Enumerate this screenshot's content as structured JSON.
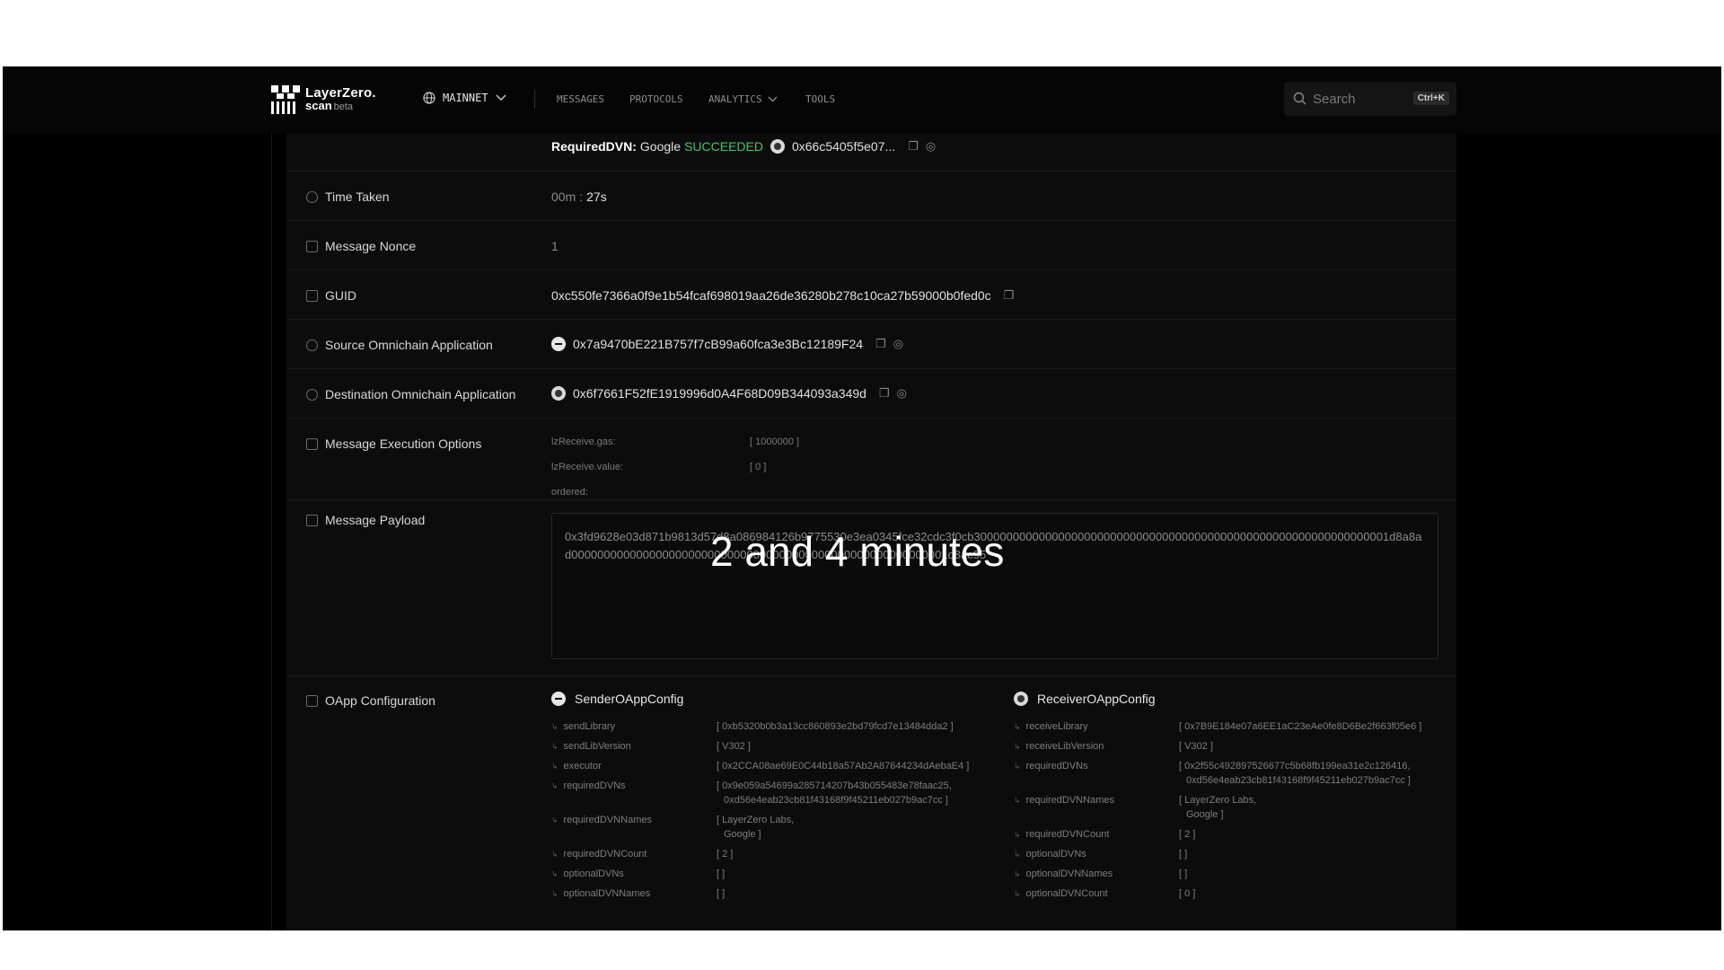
{
  "header": {
    "logo_line1": "LayerZero.",
    "logo_line2": "scan",
    "logo_badge": "beta",
    "network": "MAINNET",
    "nav": [
      "MESSAGES",
      "PROTOCOLS",
      "ANALYTICS",
      "TOOLS"
    ],
    "search_placeholder": "Search",
    "search_shortcut": "Ctrl+K"
  },
  "dvn_row": {
    "label": "RequiredDVN:",
    "name": "Google",
    "status": "SUCCEEDED",
    "address": "0x66c5405f5e07..."
  },
  "rows": {
    "time_taken": {
      "label": "Time Taken",
      "minutes": "00m",
      "sep": ":",
      "seconds": "27s"
    },
    "nonce": {
      "label": "Message Nonce",
      "value": "1"
    },
    "guid": {
      "label": "GUID",
      "value": "0xc550fe7366a0f9e1b54fcaf698019aa26de36280b278c10ca27b59000b0fed0c"
    },
    "source_oapp": {
      "label": "Source Omnichain Application",
      "value": "0x7a9470bE221B757f7cB99a60fca3e3Bc12189F24"
    },
    "dest_oapp": {
      "label": "Destination Omnichain Application",
      "value": "0x6f7661F52fE1919996d0A4F68D09B344093a349d"
    },
    "exec_options": {
      "label": "Message Execution Options",
      "items": [
        {
          "key": "lzReceive.gas:",
          "value": "[ 1000000 ]"
        },
        {
          "key": "lzReceive.value:",
          "value": "[ 0 ]"
        },
        {
          "key": "ordered:",
          "value": ""
        }
      ]
    },
    "payload": {
      "label": "Message Payload",
      "value": "0x3fd9628e03d871b9813d57d8a086984126b9775530e3ea0345fce32cdc3f0cb3000000000000000000000000000000000000000000000000000000000000001d8a8ad0000000000000000000000000000000000000000000000000000000001d8ac95"
    },
    "oapp_config": {
      "label": "OApp Configuration",
      "sender_title": "SenderOAppConfig",
      "receiver_title": "ReceiverOAppConfig",
      "sender": [
        {
          "key": "sendLibrary",
          "value": "[ 0xb5320b0b3a13cc860893e2bd79fcd7e13484dda2 ]"
        },
        {
          "key": "sendLibVersion",
          "value": "[ V302 ]"
        },
        {
          "key": "executor",
          "value": "[ 0x2CCA08ae69E0C44b18a57Ab2A87644234dAebaE4 ]"
        },
        {
          "key": "requiredDVNs",
          "value": "[ 0x9e059a54699a285714207b43b055483e78faac25,",
          "value2": "0xd56e4eab23cb81f43168f9f45211eb027b9ac7cc ]"
        },
        {
          "key": "requiredDVNNames",
          "value": "[ LayerZero Labs,",
          "value2": "Google ]"
        },
        {
          "key": "requiredDVNCount",
          "value": "[ 2 ]"
        },
        {
          "key": "optionalDVNs",
          "value": "[ ]"
        },
        {
          "key": "optionalDVNNames",
          "value": "[ ]"
        }
      ],
      "receiver": [
        {
          "key": "receiveLibrary",
          "value": "[ 0x7B9E184e07a6EE1aC23eAe0fe8D6Be2f663f05e6 ]"
        },
        {
          "key": "receiveLibVersion",
          "value": "[ V302 ]"
        },
        {
          "key": "requiredDVNs",
          "value": "[ 0x2f55c492897526677c5b68fb199ea31e2c126416,",
          "value2": "0xd56e4eab23cb81f43168f9f45211eb027b9ac7cc ]"
        },
        {
          "key": "requiredDVNNames",
          "value": "[ LayerZero Labs,",
          "value2": "Google ]"
        },
        {
          "key": "requiredDVNCount",
          "value": "[ 2 ]"
        },
        {
          "key": "optionalDVNs",
          "value": "[ ]"
        },
        {
          "key": "optionalDVNNames",
          "value": "[ ]"
        },
        {
          "key": "optionalDVNCount",
          "value": "[ 0 ]"
        }
      ]
    }
  },
  "caption": "2 and 4 minutes"
}
